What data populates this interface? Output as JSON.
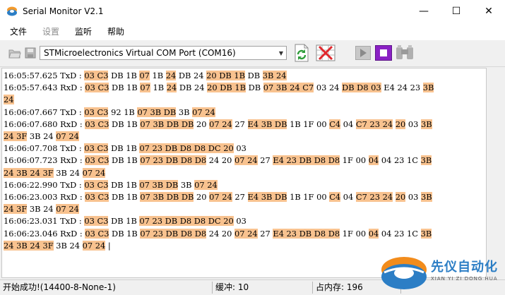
{
  "window": {
    "title": "Serial Monitor V2.1",
    "minimize": "—",
    "maximize": "☐",
    "close": "✕"
  },
  "menu": [
    {
      "label": "文件",
      "disabled": false
    },
    {
      "label": "设置",
      "disabled": true
    },
    {
      "label": "监听",
      "disabled": false
    },
    {
      "label": "帮助",
      "disabled": false
    }
  ],
  "toolbar": {
    "port": "STMicroelectronics Virtual COM Port (COM16)"
  },
  "log": [
    [
      [
        "16:05:57.625 TxD : ",
        0
      ],
      [
        "03 C3",
        1
      ],
      [
        " DB 1B ",
        0
      ],
      [
        "07",
        1
      ],
      [
        " 1B ",
        0
      ],
      [
        "24",
        1
      ],
      [
        " DB 24 ",
        0
      ],
      [
        "20 DB 1B",
        1
      ],
      [
        " DB ",
        0
      ],
      [
        "3B 24",
        1
      ]
    ],
    [
      [
        "16:05:57.643 RxD : ",
        0
      ],
      [
        "03 C3",
        1
      ],
      [
        " DB 1B ",
        0
      ],
      [
        "07",
        1
      ],
      [
        " 1B ",
        0
      ],
      [
        "24",
        1
      ],
      [
        " DB 24 ",
        0
      ],
      [
        "20 DB 1B",
        1
      ],
      [
        " DB ",
        0
      ],
      [
        "07 3B 24 C7",
        1
      ],
      [
        " 03 24 ",
        0
      ],
      [
        "DB D8 03",
        1
      ],
      [
        " E4 24 23 ",
        0
      ],
      [
        "3B",
        1
      ]
    ],
    [
      [
        "24",
        1
      ]
    ],
    [
      [
        "16:06:07.667 TxD : ",
        0
      ],
      [
        "03 C3",
        1
      ],
      [
        " 92 1B ",
        0
      ],
      [
        "07 3B DB",
        1
      ],
      [
        " 3B ",
        0
      ],
      [
        "07 24",
        1
      ]
    ],
    [
      [
        "16:06:07.680 RxD : ",
        0
      ],
      [
        "03 C3",
        1
      ],
      [
        " DB 1B ",
        0
      ],
      [
        "07 3B DB DB",
        1
      ],
      [
        " 20 ",
        0
      ],
      [
        "07 24",
        1
      ],
      [
        " 27 ",
        0
      ],
      [
        "E4 3B DB",
        1
      ],
      [
        " 1B 1F 00 ",
        0
      ],
      [
        "C4",
        1
      ],
      [
        " 04 ",
        0
      ],
      [
        "C7 23 24",
        1
      ],
      [
        " ",
        0
      ],
      [
        "20",
        1
      ],
      [
        " 03 ",
        0
      ],
      [
        "3B",
        1
      ]
    ],
    [
      [
        "24 3F",
        1
      ],
      [
        " 3B 24 ",
        0
      ],
      [
        "07 24",
        1
      ]
    ],
    [
      [
        "16:06:07.708 TxD : ",
        0
      ],
      [
        "03 C3",
        1
      ],
      [
        " DB 1B ",
        0
      ],
      [
        "07 23 DB D8 D8 DC 20",
        1
      ],
      [
        " 03",
        0
      ]
    ],
    [
      [
        "16:06:07.723 RxD : ",
        0
      ],
      [
        "03 C3",
        1
      ],
      [
        " DB 1B ",
        0
      ],
      [
        "07 23 DB D8 D8",
        1
      ],
      [
        " 24 20 ",
        0
      ],
      [
        "07 24",
        1
      ],
      [
        " 27 ",
        0
      ],
      [
        "E4 23 DB D8 D8",
        1
      ],
      [
        " 1F 00 ",
        0
      ],
      [
        "04",
        1
      ],
      [
        " 04 23 1C ",
        0
      ],
      [
        "3B",
        1
      ]
    ],
    [
      [
        "24 3B 24 3F",
        1
      ],
      [
        " 3B 24 ",
        0
      ],
      [
        "07 24",
        1
      ]
    ],
    [
      [
        "16:06:22.990 TxD : ",
        0
      ],
      [
        "03 C3",
        1
      ],
      [
        " DB 1B ",
        0
      ],
      [
        "07 3B DB",
        1
      ],
      [
        " 3B ",
        0
      ],
      [
        "07 24",
        1
      ]
    ],
    [
      [
        "16:06:23.003 RxD : ",
        0
      ],
      [
        "03 C3",
        1
      ],
      [
        " DB 1B ",
        0
      ],
      [
        "07 3B DB DB",
        1
      ],
      [
        " 20 ",
        0
      ],
      [
        "07 24",
        1
      ],
      [
        " 27 ",
        0
      ],
      [
        "E4 3B DB",
        1
      ],
      [
        " 1B 1F 00 ",
        0
      ],
      [
        "C4",
        1
      ],
      [
        " 04 ",
        0
      ],
      [
        "C7 23 24",
        1
      ],
      [
        " ",
        0
      ],
      [
        "20",
        1
      ],
      [
        " 03 ",
        0
      ],
      [
        "3B",
        1
      ]
    ],
    [
      [
        "24 3F",
        1
      ],
      [
        " 3B 24 ",
        0
      ],
      [
        "07 24",
        1
      ]
    ],
    [
      [
        "16:06:23.031 TxD : ",
        0
      ],
      [
        "03 C3",
        1
      ],
      [
        " DB 1B ",
        0
      ],
      [
        "07 23 DB D8 D8 DC 20",
        1
      ],
      [
        " 03",
        0
      ]
    ],
    [
      [
        "16:06:23.046 RxD : ",
        0
      ],
      [
        "03 C3",
        1
      ],
      [
        " DB 1B ",
        0
      ],
      [
        "07 23 DB D8 D8",
        1
      ],
      [
        " 24 20 ",
        0
      ],
      [
        "07 24",
        1
      ],
      [
        " 27 ",
        0
      ],
      [
        "E4 23 DB D8 D8",
        1
      ],
      [
        " 1F 00 ",
        0
      ],
      [
        "04",
        1
      ],
      [
        " 04 23 1C ",
        0
      ],
      [
        "3B",
        1
      ]
    ],
    [
      [
        "24 3B 24 3F",
        1
      ],
      [
        " 3B 24 ",
        0
      ],
      [
        "07 24",
        1
      ],
      [
        " |",
        0
      ]
    ]
  ],
  "status": {
    "message": "开始成功!(14400-8-None-1)",
    "buffer": "缓冲: 10",
    "memory": "占内存: 196"
  },
  "logo": {
    "cn": "先仪自动化",
    "en": "XIAN YI ZI DONG HUA"
  },
  "colors": {
    "highlight": "#f8c28f",
    "logo_blue": "#2c7ec5",
    "logo_orange": "#f28c1c"
  }
}
